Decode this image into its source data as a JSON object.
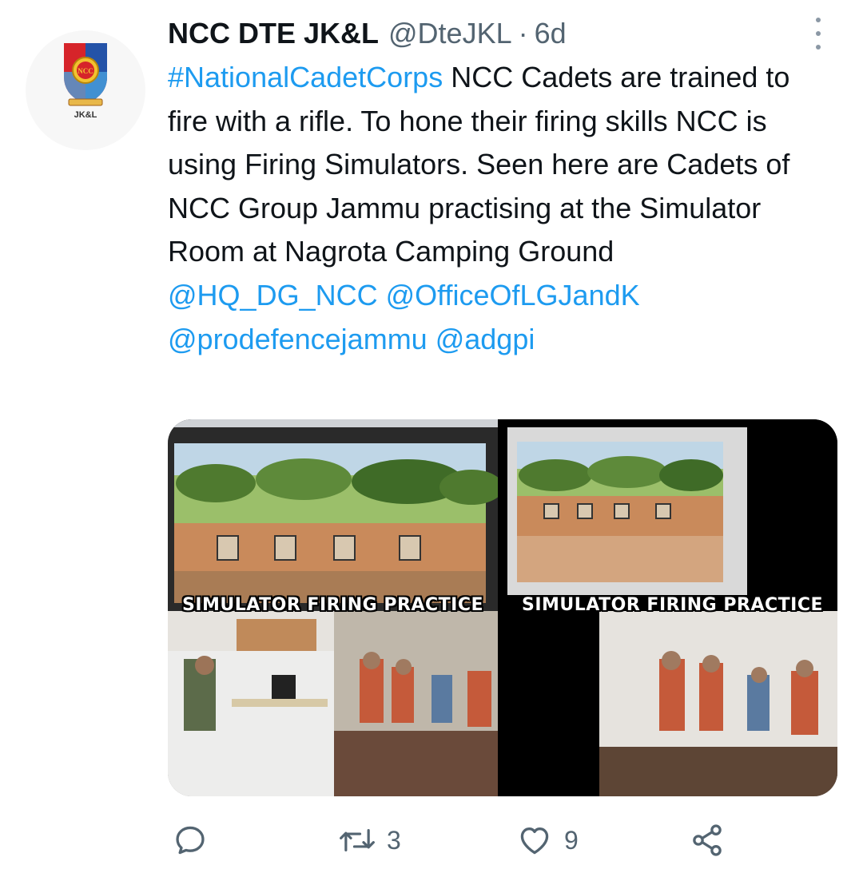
{
  "author": {
    "name": "NCC DTE JK&L",
    "handle": "@DteJKL",
    "separator": "·",
    "time": "6d",
    "avatar_caption": "JK&L",
    "avatar_emblem_text": "NCC"
  },
  "tweet": {
    "hashtag": "#NationalCadetCorps",
    "body": " NCC Cadets are trained to fire with a rifle. To hone their firing skills NCC is using Firing Simulators. Seen here are Cadets of NCC Group Jammu practising at the Simulator Room at Nagrota Camping Ground ",
    "mentions": [
      "@HQ_DG_NCC",
      "@OfficeOfLGJandK",
      "@prodefencejammu",
      "@adgpi"
    ]
  },
  "media": [
    {
      "caption": "SIMULATOR FIRING PRACTICE"
    },
    {
      "caption": "SIMULATOR FIRING PRACTICE"
    }
  ],
  "actions": {
    "reply_icon": "reply-icon",
    "retweet_icon": "retweet-icon",
    "retweet_count": "3",
    "like_icon": "heart-icon",
    "like_count": "9",
    "share_icon": "share-icon"
  },
  "colors": {
    "link": "#1d9bf0",
    "muted": "#536471",
    "text": "#0f1419"
  }
}
